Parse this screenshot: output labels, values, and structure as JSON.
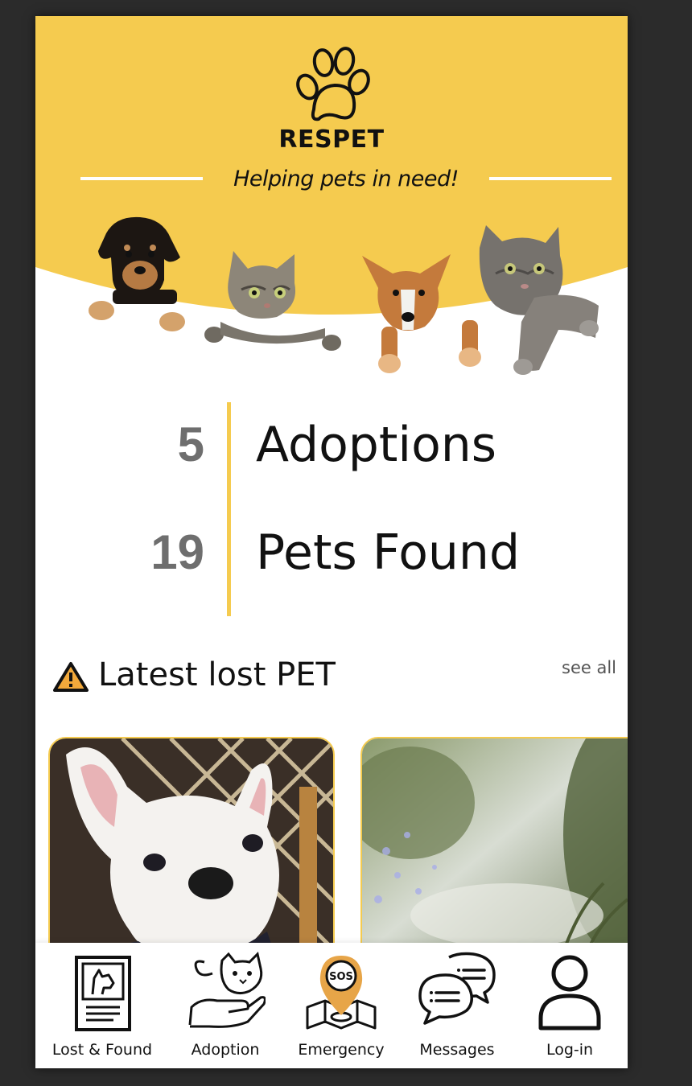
{
  "app": {
    "brand": "RESPET",
    "tagline": "Helping pets in need!"
  },
  "colors": {
    "accent": "#f5cb4f",
    "stat_number": "#6e6e6e",
    "background": "#ffffff",
    "frame": "#2b2b2b"
  },
  "stats": [
    {
      "value": "5",
      "label": "Adoptions"
    },
    {
      "value": "19",
      "label": "Pets Found"
    }
  ],
  "latest_lost": {
    "title": "Latest lost PET",
    "see_all": "see all",
    "icon": "warning-icon"
  },
  "bottom_nav": [
    {
      "label": "Lost & Found",
      "icon": "lost-found-poster-icon"
    },
    {
      "label": "Adoption",
      "icon": "adoption-hand-cat-icon"
    },
    {
      "label": "Emergency",
      "icon": "sos-map-pin-icon"
    },
    {
      "label": "Messages",
      "icon": "chat-bubbles-icon"
    },
    {
      "label": "Log-in",
      "icon": "user-icon"
    }
  ]
}
